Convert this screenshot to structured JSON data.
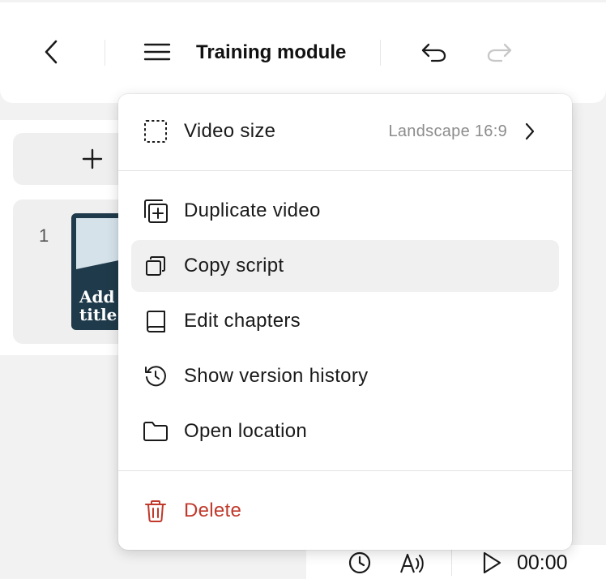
{
  "toolbar": {
    "title": "Training module",
    "icons": {
      "back": "chevron-left-icon",
      "menu": "hamburger-menu-icon",
      "undo": "undo-icon",
      "redo": "redo-icon"
    },
    "redo_enabled": false
  },
  "slides_panel": {
    "add_icon": "plus-icon",
    "slides": [
      {
        "number": "1",
        "thumbnail_text": "Add t\ntitle h"
      }
    ]
  },
  "menu": {
    "items": [
      {
        "id": "video-size",
        "label": "Video size",
        "value": "Landscape 16:9",
        "icon": "dashed-square-icon",
        "has_submenu": true
      },
      {
        "id": "duplicate-video",
        "label": "Duplicate video",
        "icon": "duplicate-plus-icon"
      },
      {
        "id": "copy-script",
        "label": "Copy script",
        "icon": "copy-icon",
        "hovered": true
      },
      {
        "id": "edit-chapters",
        "label": "Edit chapters",
        "icon": "book-icon"
      },
      {
        "id": "show-version-history",
        "label": "Show version history",
        "icon": "history-icon"
      },
      {
        "id": "open-location",
        "label": "Open location",
        "icon": "folder-icon"
      },
      {
        "id": "delete",
        "label": "Delete",
        "icon": "trash-icon",
        "danger": true
      }
    ]
  },
  "playback": {
    "time": "00:00",
    "icons": {
      "duration": "clock-icon",
      "voice": "voice-icon",
      "play": "play-icon"
    }
  },
  "colors": {
    "danger": "#c0392b",
    "hover_bg": "#f0f0f0",
    "muted_text": "#8c8c8c",
    "thumbnail_bg": "#1f3a4a"
  }
}
